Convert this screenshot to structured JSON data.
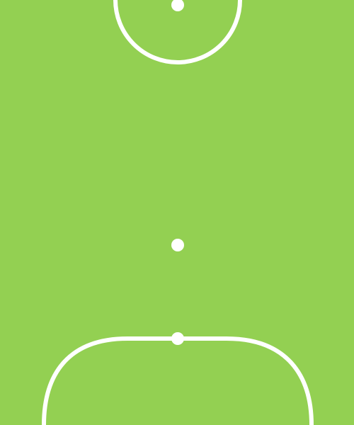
{
  "colors": {
    "field": "#93d052",
    "lines": "#ffffff"
  },
  "elements": {
    "center_circle": "center-circle",
    "center_spot": "center-spot",
    "penalty_spot": "penalty-spot",
    "penalty_area": "penalty-area",
    "penalty_area_mark": "penalty-area-mark"
  }
}
